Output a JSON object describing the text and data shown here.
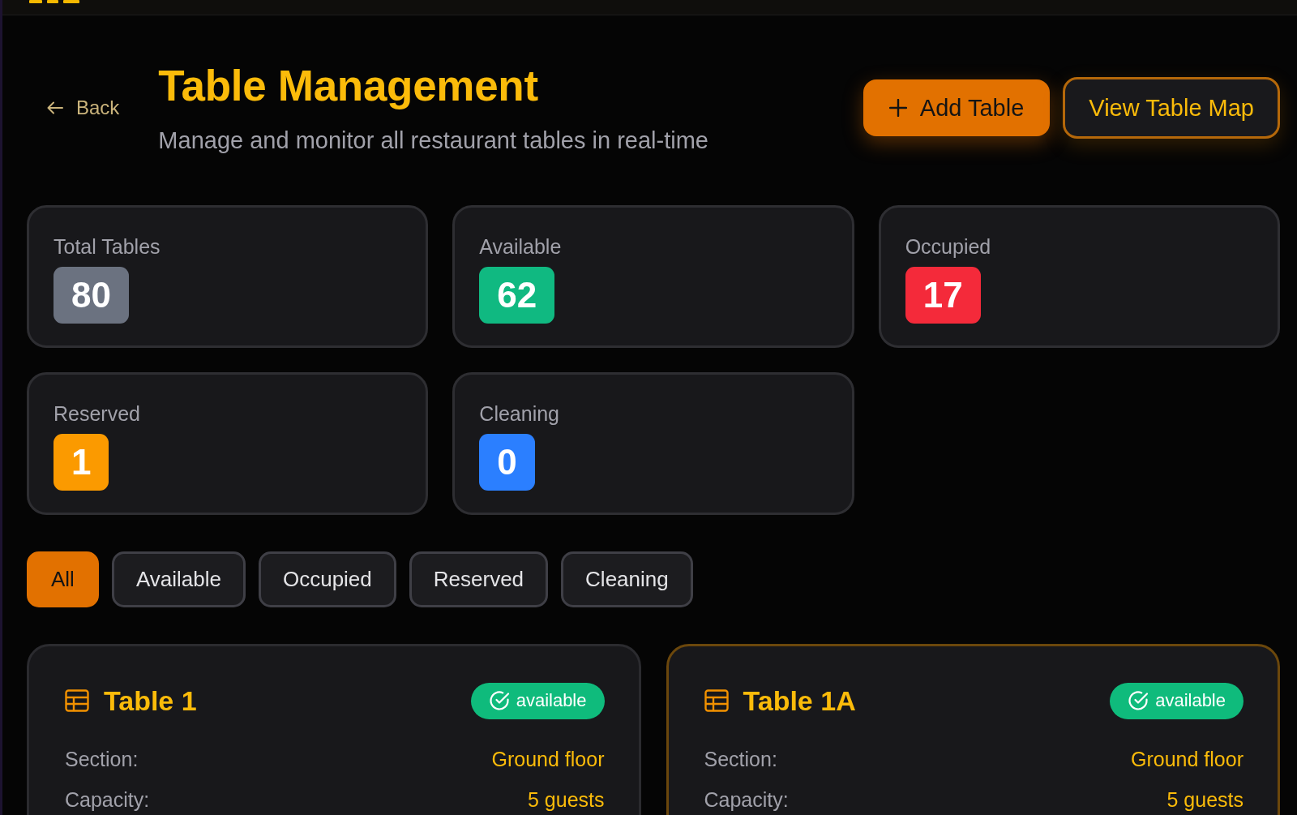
{
  "back_link": {
    "label": "Back"
  },
  "page_title": "Table Management",
  "subtitle": "Manage and monitor all restaurant tables in real-time",
  "actions": [
    {
      "label": "Add Table",
      "kind": "primary"
    },
    {
      "label": "View Table Map",
      "kind": "outline"
    }
  ],
  "stats": [
    {
      "label": "Total Tables",
      "value": "80",
      "color": "#6b7280"
    },
    {
      "label": "Available",
      "value": "62",
      "color": "#10b981"
    },
    {
      "label": "Occupied",
      "value": "17",
      "color": "#f42a3a"
    },
    {
      "label": "Reserved",
      "value": "1",
      "color": "#fb9a00"
    },
    {
      "label": "Cleaning",
      "value": "0",
      "color": "#2b7fff"
    }
  ],
  "filters": [
    {
      "label": "All",
      "selected": true
    },
    {
      "label": "Available",
      "selected": false
    },
    {
      "label": "Occupied",
      "selected": false
    },
    {
      "label": "Reserved",
      "selected": false
    },
    {
      "label": "Cleaning",
      "selected": false
    }
  ],
  "tables": [
    {
      "name": "Table 1",
      "highlighted": false,
      "status": {
        "label": "available",
        "kind": "available"
      },
      "details": [
        {
          "label": "Section:",
          "value": "Ground floor"
        },
        {
          "label": "Capacity:",
          "value": "5 guests"
        }
      ]
    },
    {
      "name": "Table 1A",
      "highlighted": true,
      "status": {
        "label": "available",
        "kind": "available"
      },
      "details": [
        {
          "label": "Section:",
          "value": "Ground floor"
        },
        {
          "label": "Capacity:",
          "value": "5 guests"
        }
      ]
    }
  ]
}
